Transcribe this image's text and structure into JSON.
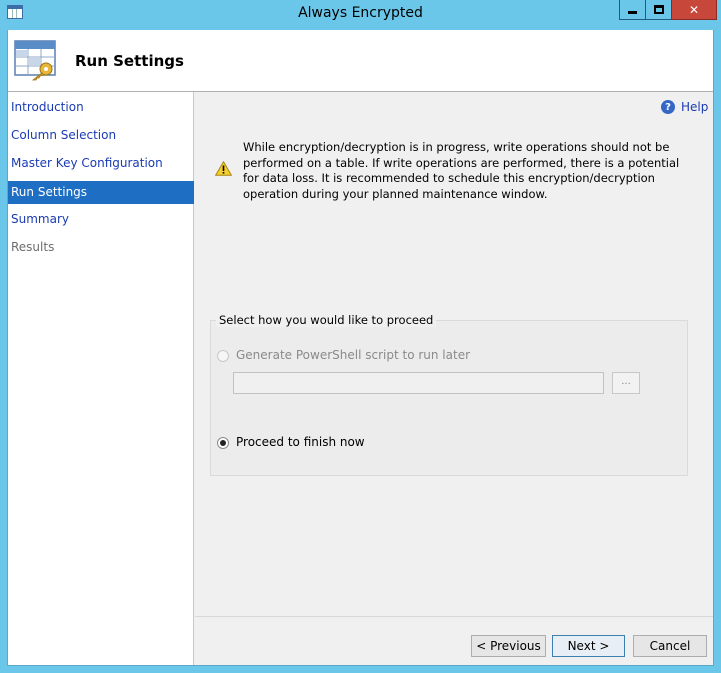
{
  "window": {
    "title": "Always Encrypted"
  },
  "header": {
    "title": "Run Settings"
  },
  "sidebar": {
    "items": [
      {
        "label": "Introduction",
        "state": "link"
      },
      {
        "label": "Column Selection",
        "state": "link"
      },
      {
        "label": "Master Key Configuration",
        "state": "link"
      },
      {
        "label": "Run Settings",
        "state": "active"
      },
      {
        "label": "Summary",
        "state": "link"
      },
      {
        "label": "Results",
        "state": "disabled"
      }
    ]
  },
  "help": {
    "label": "Help"
  },
  "warning": {
    "text": "While encryption/decryption is in progress, write operations should not be performed on a table. If write operations are performed, there is a potential for data loss. It is recommended to schedule this encryption/decryption operation during your planned maintenance window."
  },
  "proceed_group": {
    "label": "Select how you would like to proceed",
    "option_script": {
      "label": "Generate PowerShell script to run later",
      "checked": false,
      "enabled": false
    },
    "script_path": {
      "value": ""
    },
    "browse_label": "...",
    "option_now": {
      "label": "Proceed to finish now",
      "checked": true,
      "enabled": true
    }
  },
  "buttons": {
    "previous": "< Previous",
    "next": "Next >",
    "cancel": "Cancel"
  },
  "colors": {
    "titlebar": "#6bc7e9",
    "active_nav": "#1e6fc4",
    "link": "#1a3bb2",
    "close_button": "#c7483a"
  }
}
